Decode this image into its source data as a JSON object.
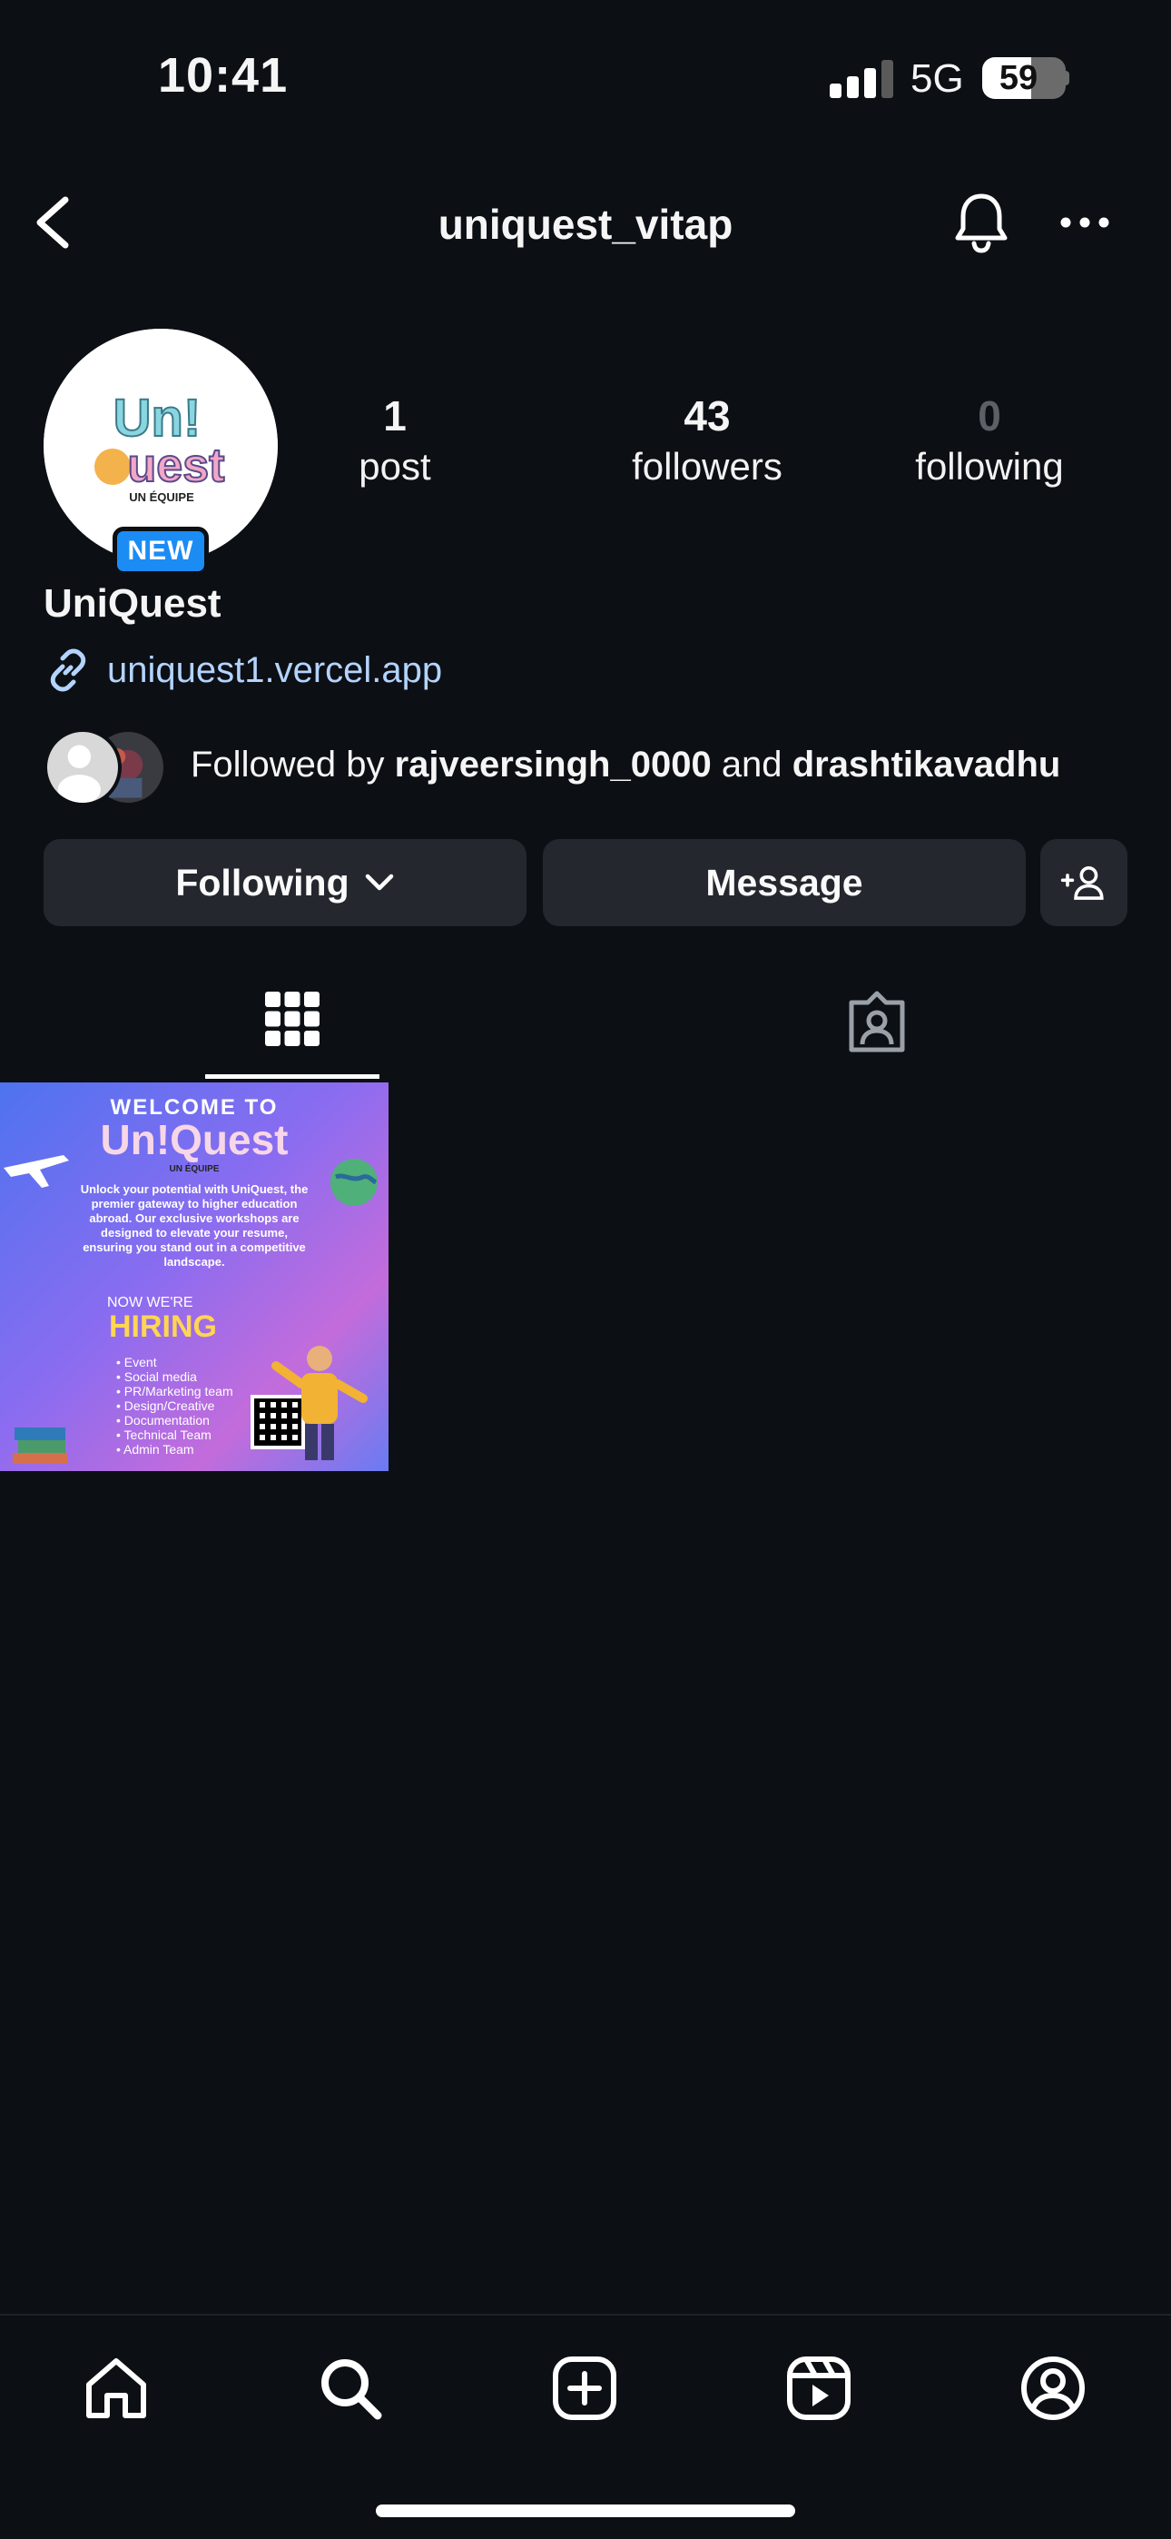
{
  "status_bar": {
    "time": "10:41",
    "network": "5G",
    "battery": "59",
    "battery_level": 0.59
  },
  "header": {
    "username": "uniquest_vitap"
  },
  "profile": {
    "badge": "NEW",
    "display_name": "UniQuest",
    "link": "uniquest1.vercel.app",
    "stats": [
      {
        "value": "1",
        "label": "post"
      },
      {
        "value": "43",
        "label": "followers"
      },
      {
        "value": "0",
        "label": "following"
      }
    ],
    "followed_by": {
      "prefix": "Followed by",
      "user1": "rajveersingh_0000",
      "joiner": "and",
      "user2": "drashtikavadhu"
    }
  },
  "actions": {
    "following_label": "Following",
    "message_label": "Message"
  },
  "tabs": [
    {
      "name": "posts-grid",
      "icon": "grid-icon",
      "selected": true
    },
    {
      "name": "tagged",
      "icon": "tagged-person-icon",
      "selected": false
    }
  ],
  "post": {
    "welcome": "WELCOME TO",
    "logo_text": "Un!Quest",
    "logo_sub": "UN ÉQUIPE",
    "paragraph": "Unlock your potential with UniQuest, the premier gateway to higher education abroad. Our exclusive workshops are designed to elevate your resume, ensuring you stand out in a competitive landscape.",
    "now": "NOW WE'RE",
    "hiring": "HIRING",
    "roles": [
      "• Event",
      "• Social media",
      "• PR/Marketing team",
      "• Design/Creative",
      "• Documentation",
      "• Technical Team",
      "• Admin Team"
    ]
  },
  "bottom_nav": [
    "home-icon",
    "search-icon",
    "create-icon",
    "reels-icon",
    "profile-icon"
  ],
  "colors": {
    "background": "#0c0f14",
    "button": "#24272e",
    "link": "#b3d4ff",
    "badge": "#1c8cf5"
  }
}
